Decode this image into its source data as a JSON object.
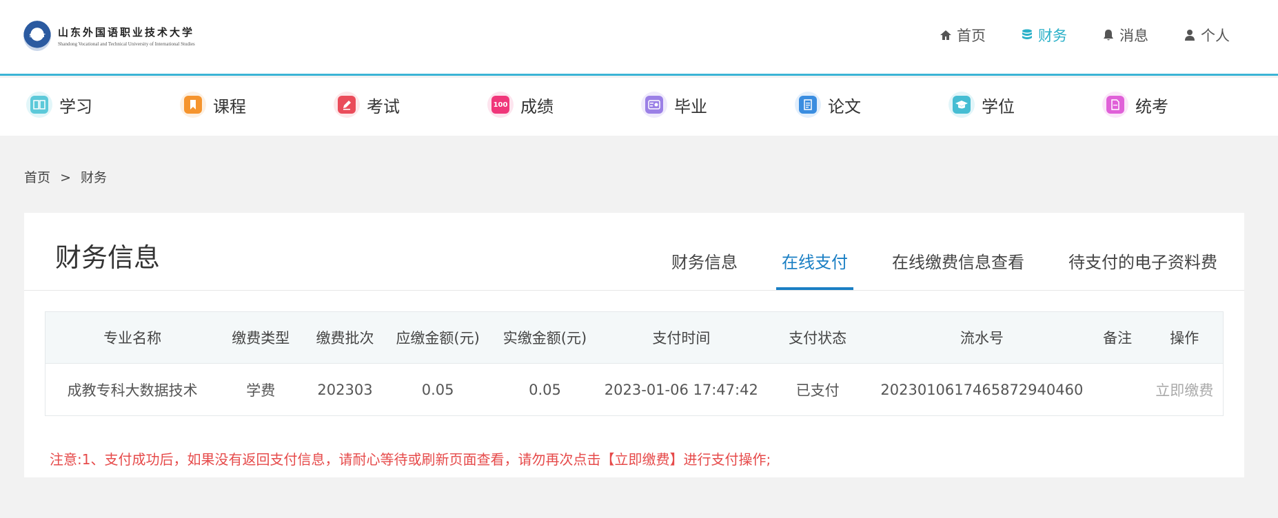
{
  "header": {
    "logo_cn": "山东外国语职业技术大学",
    "logo_en": "Shandong Vocational and Technical University of International Studies",
    "logo_emblem": "SWUT",
    "nav": [
      {
        "label": "首页",
        "icon": "home-icon"
      },
      {
        "label": "财务",
        "icon": "database-icon",
        "active": true
      },
      {
        "label": "消息",
        "icon": "bell-icon"
      },
      {
        "label": "个人",
        "icon": "user-icon"
      }
    ],
    "accent_color": "#2ab0c8"
  },
  "modules": [
    {
      "label": "学习",
      "icon": "book-open-icon",
      "color": "#5cc9d9",
      "bg": "#e2f6f9"
    },
    {
      "label": "课程",
      "icon": "bookmark-icon",
      "color": "#f5942e",
      "bg": "#fdf0e2"
    },
    {
      "label": "考试",
      "icon": "pencil-icon",
      "color": "#ea4c5a",
      "bg": "#fde8ea"
    },
    {
      "label": "成绩",
      "icon": "score-100-icon",
      "color": "#f0367a",
      "bg": "#fde4ee"
    },
    {
      "label": "毕业",
      "icon": "certificate-icon",
      "color": "#9b80e6",
      "bg": "#efeafc"
    },
    {
      "label": "论文",
      "icon": "document-icon",
      "color": "#3a8de0",
      "bg": "#e3effc"
    },
    {
      "label": "学位",
      "icon": "graduation-cap-icon",
      "color": "#46bdd3",
      "bg": "#e2f5f9"
    },
    {
      "label": "统考",
      "icon": "file-stack-icon",
      "color": "#e060d8",
      "bg": "#fbe6f9"
    }
  ],
  "breadcrumb": {
    "home": "首页",
    "separator": ">",
    "current": "财务"
  },
  "card": {
    "title": "财务信息",
    "tabs": [
      "财务信息",
      "在线支付",
      "在线缴费信息查看",
      "待支付的电子资料费"
    ],
    "active_tab": 1
  },
  "table": {
    "columns": [
      "专业名称",
      "缴费类型",
      "缴费批次",
      "应缴金额(元)",
      "实缴金额(元)",
      "支付时间",
      "支付状态",
      "流水号",
      "备注",
      "操作"
    ],
    "rows": [
      [
        "成教专科大数据技术",
        "学费",
        "202303",
        "0.05",
        "0.05",
        "2023-01-06 17:47:42",
        "已支付",
        "202301061746587294046​0",
        "",
        "立即缴费"
      ]
    ]
  },
  "notice": "注意:1、支付成功后，如果没有返回支付信息，请耐心等待或刷新页面查看，请勿再次点击【立即缴费】进行支付操作;"
}
